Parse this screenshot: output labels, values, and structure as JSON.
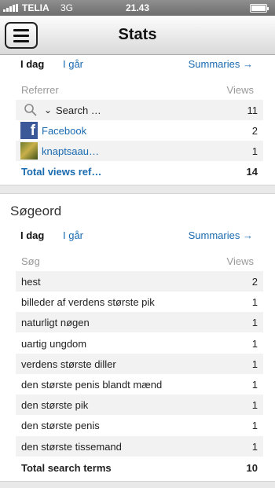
{
  "status_bar": {
    "carrier": "TELIA",
    "network": "3G",
    "time": "21.43"
  },
  "header": {
    "title": "Stats"
  },
  "referrers": {
    "tabs": {
      "today": "I dag",
      "yesterday": "I går",
      "summaries": "Summaries"
    },
    "columns": {
      "label": "Referrer",
      "views": "Views"
    },
    "search_row": {
      "label": "Search …",
      "views": "11"
    },
    "rows": [
      {
        "label": "Facebook",
        "views": "2"
      },
      {
        "label": "knaptsaau…",
        "views": "1"
      }
    ],
    "total": {
      "label": "Total views ref…",
      "views": "14"
    }
  },
  "search_terms": {
    "title": "Søgeord",
    "tabs": {
      "today": "I dag",
      "yesterday": "I går",
      "summaries": "Summaries"
    },
    "columns": {
      "label": "Søg",
      "views": "Views"
    },
    "rows": [
      {
        "label": "hest",
        "views": "2"
      },
      {
        "label": "billeder af verdens største pik",
        "views": "1"
      },
      {
        "label": "naturligt nøgen",
        "views": "1"
      },
      {
        "label": "uartig ungdom",
        "views": "1"
      },
      {
        "label": "verdens største diller",
        "views": "1"
      },
      {
        "label": "den største penis blandt mænd",
        "views": "1"
      },
      {
        "label": "den største pik",
        "views": "1"
      },
      {
        "label": "den største penis",
        "views": "1"
      },
      {
        "label": "den største tissemand",
        "views": "1"
      }
    ],
    "total": {
      "label": "Total search terms",
      "views": "10"
    }
  },
  "icons": {
    "menu": "hamburger-menu-icon",
    "search": "search-icon",
    "facebook": "facebook-icon",
    "arrow": "right-arrow-icon"
  },
  "colors": {
    "link": "#1a6ab0",
    "facebook": "#3b5998"
  }
}
